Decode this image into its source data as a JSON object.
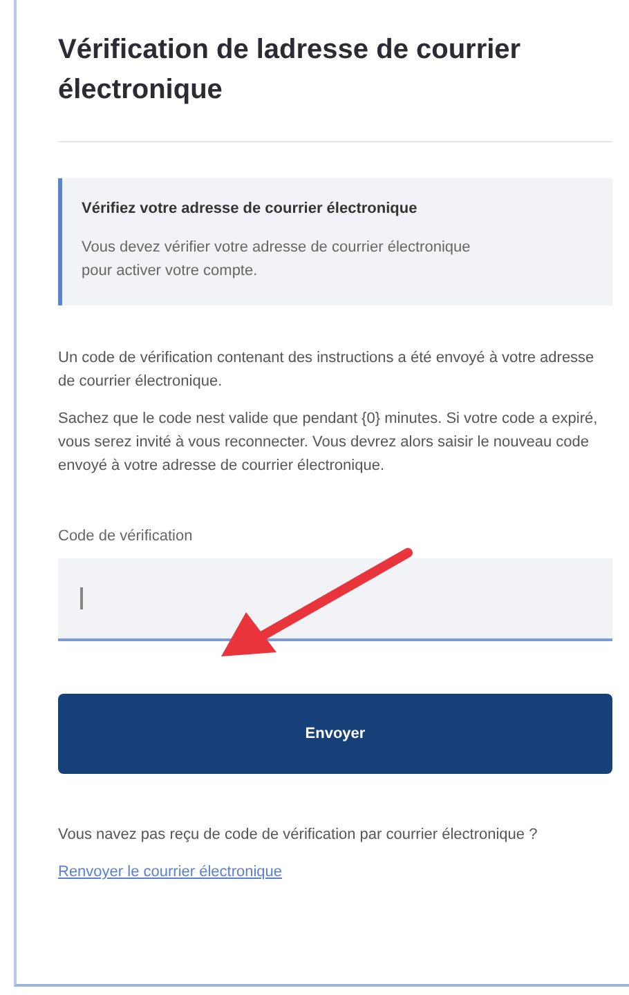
{
  "title": "Vérification de ladresse de courrier électronique",
  "alert": {
    "title": "Vérifiez votre adresse de courrier électronique",
    "text": "Vous devez vérifier votre adresse de courrier électronique pour activer votre compte."
  },
  "paragraphs": [
    "Un code de vérification contenant des instructions a été envoyé à votre adresse de courrier électronique.",
    "Sachez que le code nest valide que pendant {0} minutes. Si votre code a expiré, vous serez invité à vous reconnecter. Vous devrez alors saisir le nouveau code envoyé à votre adresse de courrier électronique."
  ],
  "field": {
    "label": "Code de vérification",
    "focused": true
  },
  "button": "Envoyer",
  "footer_text": "Vous navez pas reçu de code de vérification par courrier électronique ?",
  "link": "Renvoyer le courrier électronique"
}
